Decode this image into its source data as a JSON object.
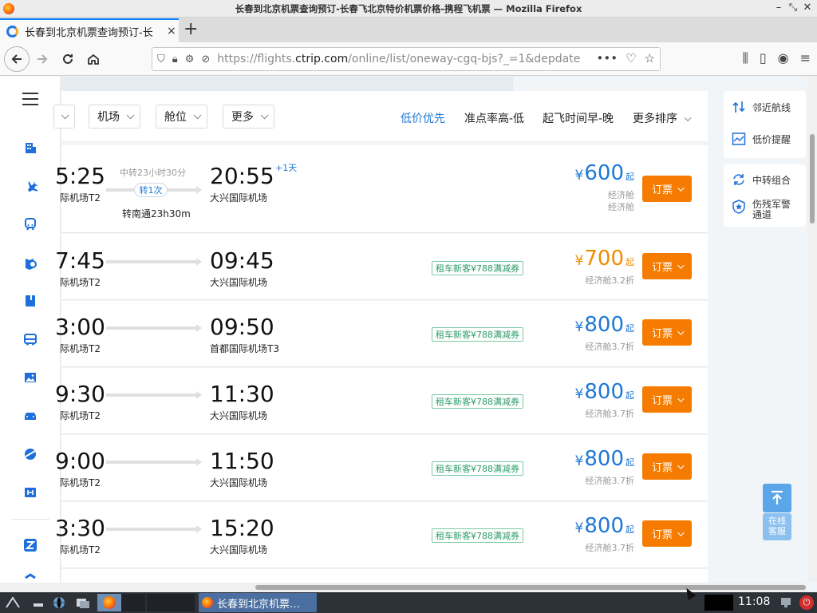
{
  "window": {
    "title": "长春到北京机票查询预订-长春飞北京特价机票价格-携程飞机票 — Mozilla Firefox",
    "minimize": "–",
    "restore": "⤡",
    "close": "✕"
  },
  "tabs": [
    {
      "title": "长春到北京机票查询预订-长",
      "close": "×"
    }
  ],
  "newtab": "+",
  "url": {
    "prefix": "https://flights.",
    "host": "ctrip.com",
    "path": "/online/list/oneway-cgq-bjs?_=1&depdate"
  },
  "url_actions": [
    "•••",
    "♡",
    "☆"
  ],
  "filters": [
    {
      "label": ""
    },
    {
      "label": "机场"
    },
    {
      "label": "舱位"
    },
    {
      "label": "更多"
    }
  ],
  "sort_options": [
    {
      "label": "低价优先",
      "active": true
    },
    {
      "label": "准点率高-低",
      "active": false
    },
    {
      "label": "起飞时间早-晚",
      "active": false
    },
    {
      "label": "更多排序",
      "active": false
    }
  ],
  "flights": [
    {
      "dep_time": "5:25",
      "dep_airport": "际机场T2",
      "arr_time": "20:55",
      "arr_airport": "大兴国际机场",
      "transfer_time": "中转23小时30分",
      "transfer_badge": "转1次",
      "transfer_city": "转南通23h30m",
      "plus_day": "+1天",
      "promo": "",
      "yen": "¥",
      "price": "600",
      "qi": "起",
      "cabin1": "经济舱",
      "cabin2": "经济舱",
      "book": "订票"
    },
    {
      "dep_time": "7:45",
      "dep_airport": "际机场T2",
      "arr_time": "09:45",
      "arr_airport": "大兴国际机场",
      "promo": "租车新客¥788满减券",
      "yen": "¥",
      "price": "700",
      "qi": "起",
      "cabin1": "经济舱3.2折",
      "book": "订票"
    },
    {
      "dep_time": "3:00",
      "dep_airport": "际机场T2",
      "arr_time": "09:50",
      "arr_airport": "首都国际机场T3",
      "promo": "租车新客¥788满减券",
      "yen": "¥",
      "price": "800",
      "qi": "起",
      "cabin1": "经济舱3.7折",
      "book": "订票"
    },
    {
      "dep_time": "9:30",
      "dep_airport": "际机场T2",
      "arr_time": "11:30",
      "arr_airport": "大兴国际机场",
      "promo": "租车新客¥788满减券",
      "yen": "¥",
      "price": "800",
      "qi": "起",
      "cabin1": "经济舱3.7折",
      "book": "订票"
    },
    {
      "dep_time": "9:00",
      "dep_airport": "际机场T2",
      "arr_time": "11:50",
      "arr_airport": "大兴国际机场",
      "promo": "租车新客¥788满减券",
      "yen": "¥",
      "price": "800",
      "qi": "起",
      "cabin1": "经济舱3.7折",
      "book": "订票"
    },
    {
      "dep_time": "3:30",
      "dep_airport": "际机场T2",
      "arr_time": "15:20",
      "arr_airport": "大兴国际机场",
      "promo": "租车新客¥788满减券",
      "yen": "¥",
      "price": "800",
      "qi": "起",
      "cabin1": "经济舱3.7折",
      "book": "订票"
    }
  ],
  "right_panel": {
    "nearby_routes": "邻近航线",
    "price_alert": "低价提醒",
    "transfer_combo": "中转组合",
    "disabled_channel_line1": "伤残军警",
    "disabled_channel_line2": "通道"
  },
  "online_service": {
    "line1": "在线",
    "line2": "客服"
  },
  "taskbar": {
    "window_title": "长春到北京机票…",
    "clock": "11:08"
  },
  "colors": {
    "accent_blue": "#1e78d4",
    "book_orange": "#f57c00",
    "price_orange": "#f08c00",
    "promo_green": "#2a9b6a"
  }
}
